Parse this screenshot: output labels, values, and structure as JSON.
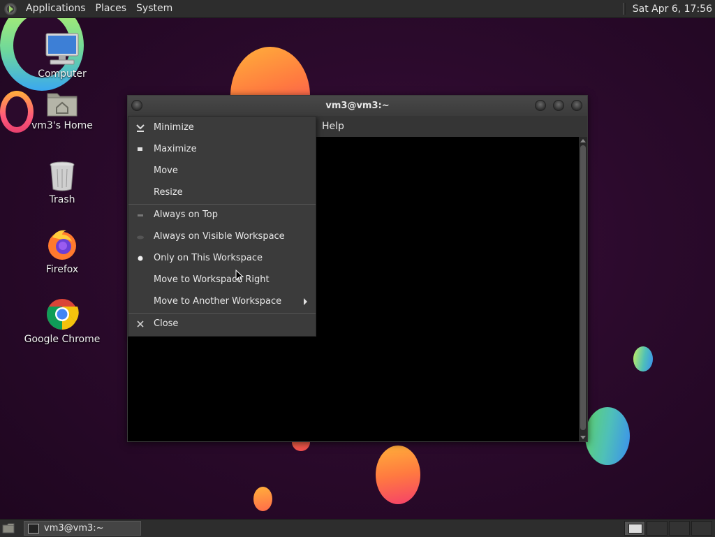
{
  "top_panel": {
    "menus": [
      "Applications",
      "Places",
      "System"
    ],
    "clock": "Sat Apr  6, 17:56"
  },
  "desktop_icons": {
    "computer": "Computer",
    "home": "vm3's Home",
    "trash": "Trash",
    "firefox": "Firefox",
    "chrome": "Google Chrome"
  },
  "terminal_window": {
    "title": "vm3@vm3:~",
    "menu_visible": "Help"
  },
  "window_menu": {
    "items": [
      {
        "label": "Minimize",
        "icon": "minimize-icon"
      },
      {
        "label": "Maximize",
        "icon": "maximize-icon"
      },
      {
        "label": "Move",
        "icon": ""
      },
      {
        "label": "Resize",
        "icon": ""
      },
      {
        "label": "Always on Top",
        "icon": "unchecked-indicator-icon"
      },
      {
        "label": "Always on Visible Workspace",
        "icon": "unchecked-radio-icon"
      },
      {
        "label": "Only on This Workspace",
        "icon": "radio-selected-icon"
      },
      {
        "label": "Move to Workspace Right",
        "icon": ""
      },
      {
        "label": "Move to Another Workspace",
        "icon": "submenu-arrow-icon"
      },
      {
        "label": "Close",
        "icon": "close-icon"
      }
    ]
  },
  "bottom_panel": {
    "task": "vm3@vm3:~"
  },
  "colors": {
    "panel": "#2d2d2d",
    "menu_bg": "#3b3b3b",
    "desktop_bg": "#2b0a2c"
  }
}
